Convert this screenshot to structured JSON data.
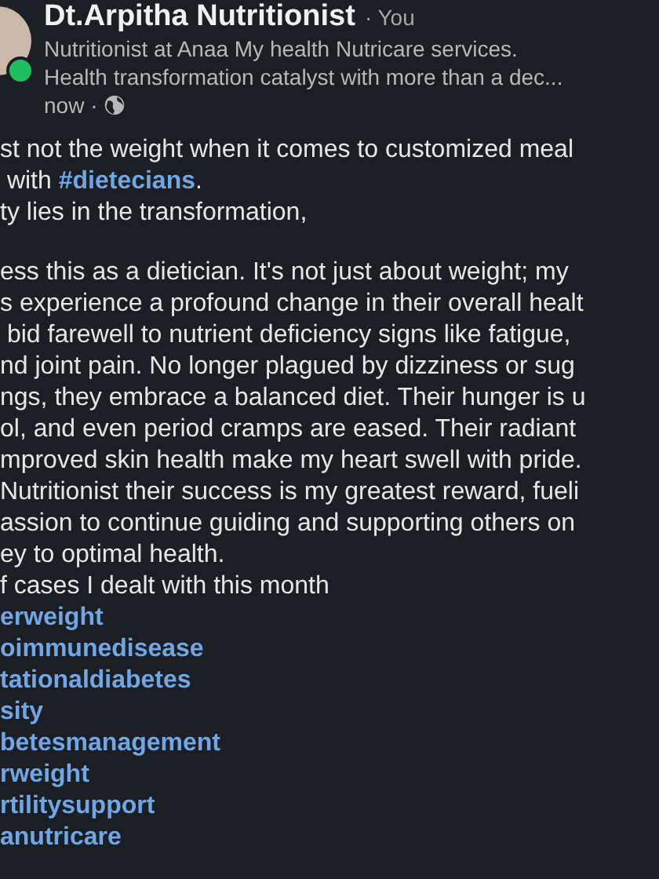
{
  "author": {
    "name": "Dt.Arpitha Nutritionist",
    "relation": "· You",
    "online": true,
    "headline": [
      "Nutritionist at Anaa My health Nutricare services.",
      "Health transformation catalyst with more than a dec..."
    ],
    "time": "now ·"
  },
  "body": [
    [
      [
        {
          "kind": "plain",
          "text": "st not the weight when it comes to customized meal"
        }
      ],
      [
        {
          "kind": "plain",
          "text": " with "
        },
        {
          "kind": "hashtag",
          "text": "#dietecians"
        },
        {
          "kind": "plain",
          "text": "."
        }
      ],
      [
        {
          "kind": "plain",
          "text": "ty lies in the transformation,"
        }
      ]
    ],
    [
      [
        {
          "kind": "plain",
          "text": "ess this as a dietician. It's not just about weight; my"
        }
      ],
      [
        {
          "kind": "plain",
          "text": "s experience a profound change in their overall healt"
        }
      ],
      [
        {
          "kind": "plain",
          "text": " bid farewell to nutrient deficiency signs like fatigue,"
        }
      ],
      [
        {
          "kind": "plain",
          "text": "nd joint pain. No longer plagued by dizziness or sug"
        }
      ],
      [
        {
          "kind": "plain",
          "text": "ngs, they embrace a balanced diet. Their hunger is u"
        }
      ],
      [
        {
          "kind": "plain",
          "text": "ol, and even period cramps are eased. Their radiant"
        }
      ],
      [
        {
          "kind": "plain",
          "text": "mproved skin health make my heart swell with pride."
        }
      ],
      [
        {
          "kind": "plain",
          "text": "Nutritionist their success is my greatest reward, fueli"
        }
      ],
      [
        {
          "kind": "plain",
          "text": "assion to continue guiding and supporting others on"
        }
      ],
      [
        {
          "kind": "plain",
          "text": "ey to optimal health."
        }
      ],
      [
        {
          "kind": "plain",
          "text": "f cases I dealt with this month"
        }
      ],
      [
        {
          "kind": "hashtag",
          "text": "erweight"
        }
      ],
      [
        {
          "kind": "hashtag",
          "text": "oimmunedisease"
        }
      ],
      [
        {
          "kind": "hashtag",
          "text": "tationaldiabetes"
        }
      ],
      [
        {
          "kind": "hashtag",
          "text": "sity"
        }
      ],
      [
        {
          "kind": "hashtag",
          "text": "betesmanagement"
        }
      ],
      [
        {
          "kind": "hashtag",
          "text": "rweight"
        }
      ],
      [
        {
          "kind": "hashtag",
          "text": "rtilitysupport"
        }
      ],
      [
        {
          "kind": "hashtag",
          "text": "anutricare"
        }
      ]
    ]
  ]
}
